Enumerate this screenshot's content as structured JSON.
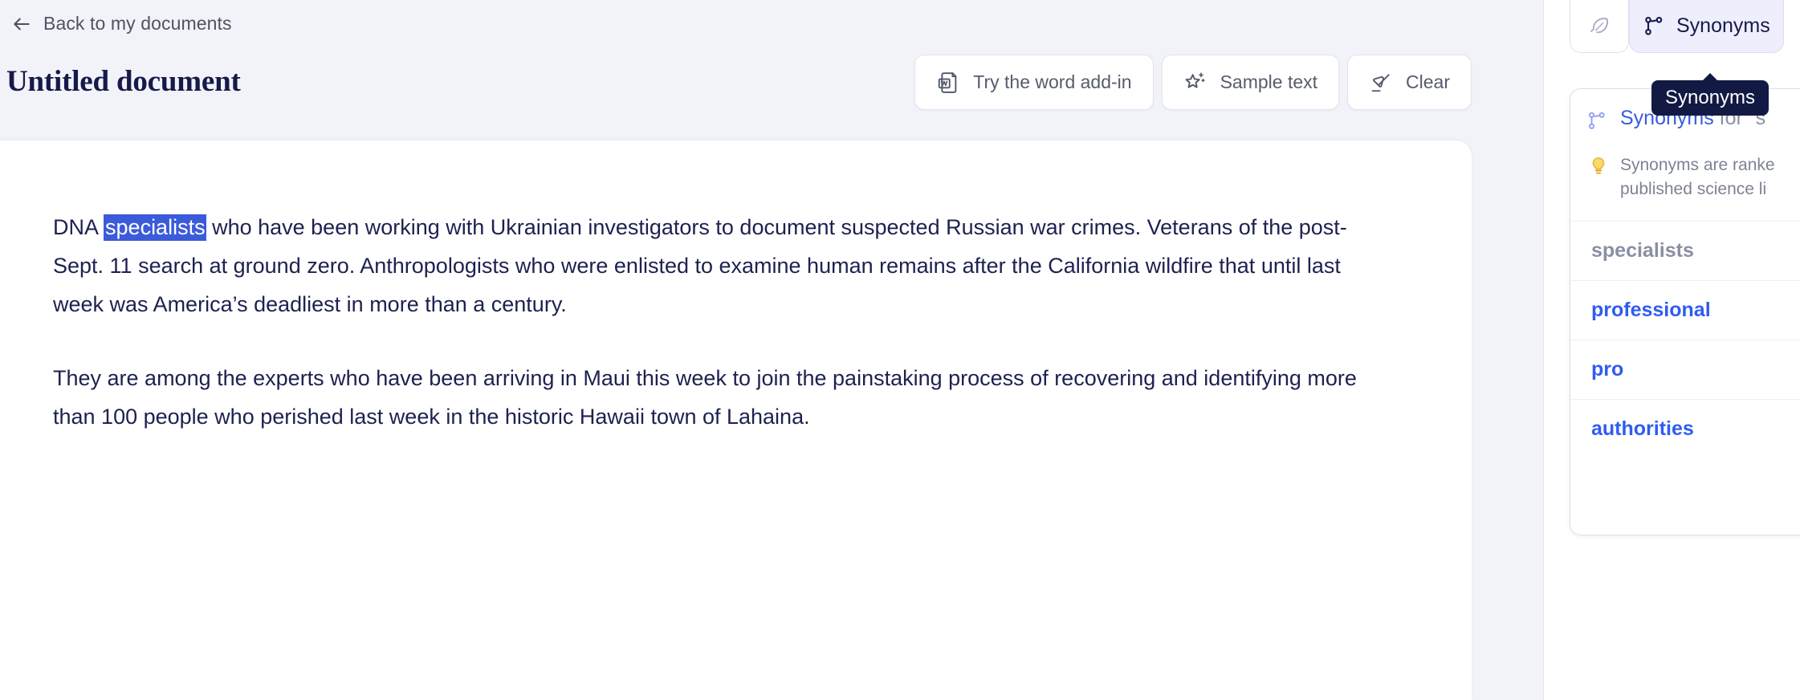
{
  "nav": {
    "back_label": "Back to my documents",
    "back_icon": "arrow-left-icon"
  },
  "header": {
    "title": "Untitled document"
  },
  "toolbar": {
    "buttons": [
      {
        "label": "Try the word add-in",
        "icon": "word-document-icon"
      },
      {
        "label": "Sample text",
        "icon": "sparkle-star-icon"
      },
      {
        "label": "Clear",
        "icon": "eraser-icon"
      }
    ]
  },
  "document": {
    "paragraph1": {
      "before": "DNA ",
      "selected": "specialists",
      "after": " who have been working with Ukrainian investigators to document suspected Russian war crimes. Veterans of the post-Sept. 11 search at ground zero. Anthropologists who were enlisted to examine human remains after the California wildfire that until last week was America’s deadliest in more than a century."
    },
    "paragraph2": "They are among the experts who have been arriving in Maui this week to join the painstaking process of recovering and identifying more than 100 people who perished last week in the historic Hawaii town of Lahaina."
  },
  "right_panel": {
    "tabs": [
      {
        "label": "",
        "icon": "feather-pen-icon",
        "active": false
      },
      {
        "label": "Synonyms",
        "icon": "synonyms-branch-icon",
        "active": true
      }
    ],
    "tooltip": "Synonyms",
    "card": {
      "heading_strong": "Synonyms",
      "heading_rest": " for \"s",
      "heading_icon": "synonyms-branch-icon",
      "tip_icon": "lightbulb-icon",
      "tip_line1": "Synonyms are ranke",
      "tip_line2": "published science li",
      "items": [
        {
          "label": "specialists",
          "state": "current"
        },
        {
          "label": "professional",
          "state": "link"
        },
        {
          "label": "pro",
          "state": "link"
        },
        {
          "label": "authorities",
          "state": "link"
        }
      ]
    }
  },
  "colors": {
    "page_background": "#f2f2f9",
    "paper": "#ffffff",
    "title": "#161a4a",
    "selection": "#3b5bdb",
    "link": "#2f5cf0",
    "muted": "#8a8fa3",
    "tooltip_bg": "#121a43",
    "tab_active_bg": "#eeeefc"
  }
}
